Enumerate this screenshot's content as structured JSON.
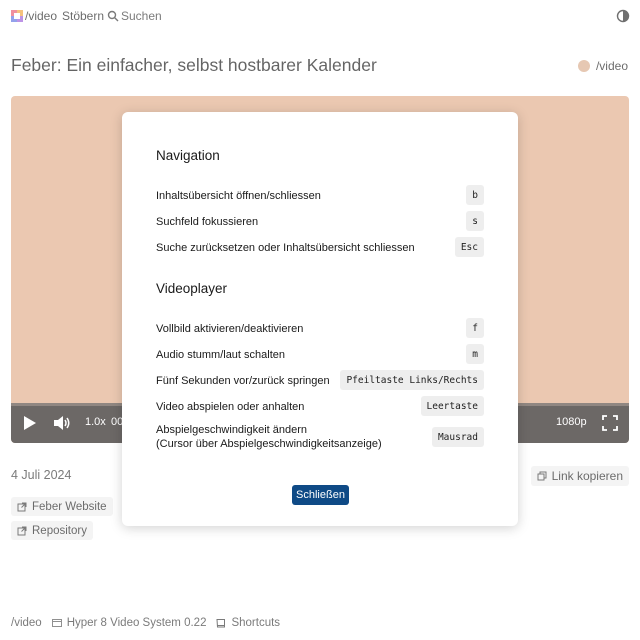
{
  "header": {
    "brand": "/video",
    "browse": "Stöbern",
    "search": "Suchen"
  },
  "page": {
    "title": "Feber: Ein einfacher, selbst hostbarer Kalender",
    "channel": "/video",
    "date": "4 Juli 2024",
    "copy_link": "Link kopieren",
    "links": [
      "Feber Website",
      "Repository"
    ]
  },
  "player": {
    "speed": "1.0x",
    "time": "00",
    "quality": "1080p",
    "progress": 0
  },
  "modal": {
    "sections": [
      {
        "title": "Navigation",
        "rows": [
          {
            "label": "Inhaltsübersicht öffnen/schliessen",
            "key": "b"
          },
          {
            "label": "Suchfeld fokussieren",
            "key": "s"
          },
          {
            "label": "Suche zurücksetzen oder Inhaltsübersicht schliessen",
            "key": "Esc"
          }
        ]
      },
      {
        "title": "Videoplayer",
        "rows": [
          {
            "label": "Vollbild aktivieren/deaktivieren",
            "key": "f"
          },
          {
            "label": "Audio stumm/laut schalten",
            "key": "m"
          },
          {
            "label": "Fünf Sekunden vor/zurück springen",
            "key": "Pfeiltaste Links/Rechts"
          },
          {
            "label": "Video abspielen oder anhalten",
            "key": "Leertaste"
          },
          {
            "label": "Abspielgeschwindigkeit ändern",
            "label2": "(Cursor über Abspielgeschwindigkeitsanzeige)",
            "key": "Mausrad"
          }
        ]
      }
    ],
    "close": "Schließen"
  },
  "footer": {
    "brand": "/video",
    "system": "Hyper 8 Video System 0.22",
    "shortcuts": "Shortcuts"
  },
  "colors": {
    "video_bg": "#e0ab88",
    "controls_bg": "#1e1714",
    "accent": "#0f4a86",
    "channel_dot": "#d9ab8a"
  },
  "icons": [
    "logo-icon",
    "search-icon",
    "theme-toggle-icon",
    "play-icon",
    "volume-icon",
    "fullscreen-icon",
    "external-link-icon",
    "copy-icon",
    "book-icon"
  ]
}
